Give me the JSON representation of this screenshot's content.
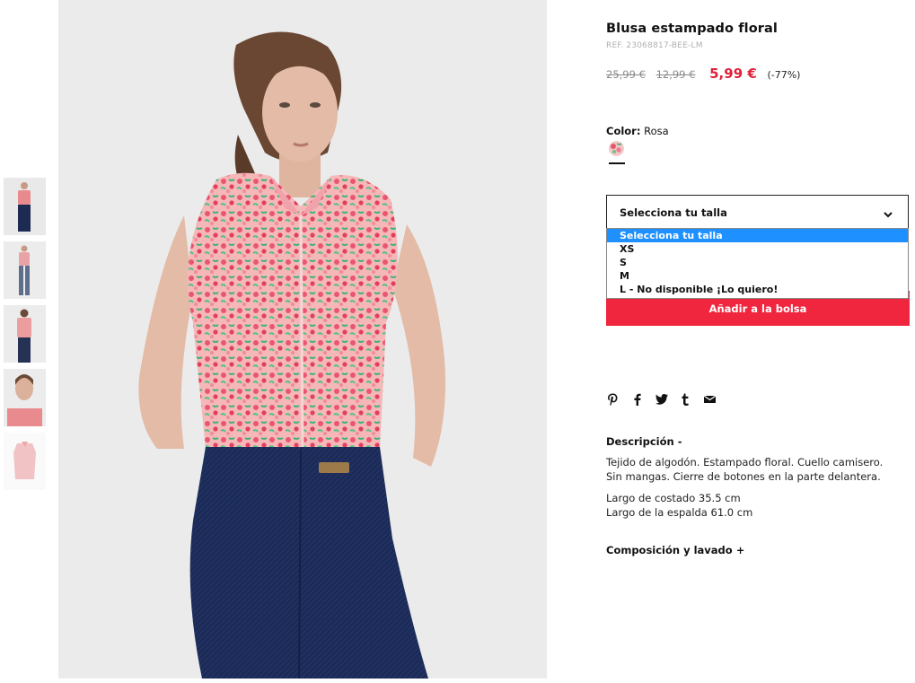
{
  "product": {
    "title": "Blusa estampado floral",
    "ref": "REF. 23068817-BEE-LM",
    "price_original": "25,99 €",
    "price_previous": "12,99 €",
    "price_sale": "5,99 €",
    "discount": "(-77%)"
  },
  "color": {
    "label": "Color:",
    "value": "Rosa"
  },
  "size_select": {
    "label": "Selecciona tu talla",
    "options": [
      "Selecciona tu talla",
      "XS",
      "S",
      "M",
      "L - No disponible ¡Lo quiero!"
    ],
    "highlighted_index": 0
  },
  "add_to_bag": "Añadir a la bolsa",
  "share_icons": [
    "pinterest-icon",
    "facebook-icon",
    "twitter-icon",
    "tumblr-icon",
    "email-icon"
  ],
  "description": {
    "heading": "Descripción -",
    "text": "Tejido de algodón. Estampado floral. Cuello camisero. Sin mangas. Cierre de botones en la parte delantera.",
    "measure_1": "Largo de costado 35.5 cm",
    "measure_2": "Largo de la espalda 61.0 cm"
  },
  "composition_heading": "Composición y lavado +",
  "colors": {
    "accent": "#f0263f",
    "sale_price": "#e0213a",
    "dropdown_highlight": "#1e90ff"
  }
}
